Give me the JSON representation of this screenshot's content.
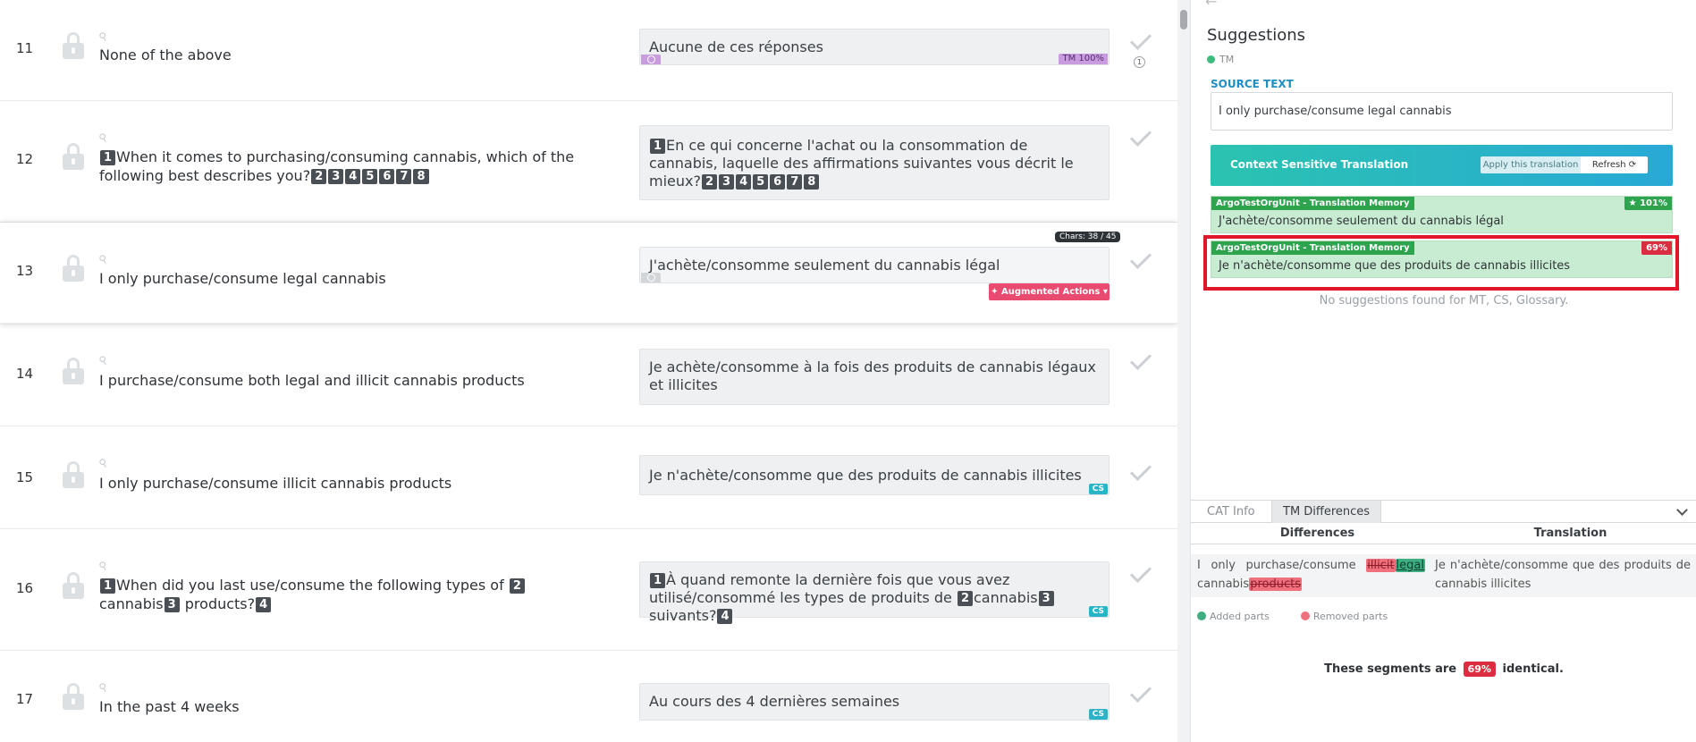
{
  "segments": [
    {
      "num": "11",
      "source": "None of the above",
      "target": "Aucune de ces réponses",
      "badge": "TM 100%"
    },
    {
      "num": "12",
      "source_a": "When it comes to purchasing/consuming cannabis, which of the following best describes you?",
      "tags_src": [
        "1",
        "2",
        "3",
        "4",
        "5",
        "6",
        "7",
        "8"
      ],
      "target_a": "En ce qui concerne l'achat ou la consommation de cannabis, laquelle des affirmations suivantes vous décrit le mieux?"
    },
    {
      "num": "13",
      "source": "I only purchase/consume legal cannabis",
      "target": "J'achète/consomme seulement du cannabis légal",
      "chars": "Chars: 38 / 45",
      "augmented": "Augmented Actions"
    },
    {
      "num": "14",
      "source": "I purchase/consume both legal and illicit cannabis products",
      "target": "Je achète/consomme à la fois des produits de cannabis légaux et illicites"
    },
    {
      "num": "15",
      "source": "I only purchase/consume illicit cannabis products",
      "target": "Je n'achète/consomme que des produits de cannabis illicites",
      "badge": "CS"
    },
    {
      "num": "16",
      "source_a": "When did you last use/consume the following types of",
      "source_b": "cannabis",
      "source_c": "products?",
      "target_a": "À quand remonte la dernière fois que vous avez utilisé/consommé les types de produits de",
      "target_b": "cannabis",
      "target_c": "suivants?",
      "badge": "CS"
    },
    {
      "num": "17",
      "source": "In the past 4 weeks",
      "target": "Au cours des 4 dernières semaines",
      "badge": "CS"
    }
  ],
  "panel": {
    "title": "Suggestions",
    "tm_legend": "TM",
    "source_label": "SOURCE TEXT",
    "source_text": "I only purchase/consume legal cannabis",
    "cst_label": "Context Sensitive Translation",
    "apply_label": "Apply this translation",
    "refresh_label": "Refresh",
    "tm1": {
      "org": "ArgoTestOrgUnit - Translation Memory",
      "pct": "101%",
      "text": "J'achète/consomme seulement du cannabis légal"
    },
    "tm2": {
      "org": "ArgoTestOrgUnit - Translation Memory",
      "pct": "69%",
      "text": "Je n'achète/consomme que des produits de cannabis illicites"
    },
    "no_suggestions": "No suggestions found for MT, CS, Glossary.",
    "tab_cat": "CAT Info",
    "tab_tmdiff": "TM Differences",
    "diff_head": "Differences",
    "trans_head": "Translation",
    "diff_pre": "I only purchase/consume",
    "diff_removed1": "illicit",
    "diff_added": "legal",
    "diff_mid": "cannabis",
    "diff_removed2": "products",
    "diff_translation": "Je n'achète/consomme que des produits de cannabis illicites",
    "legend_added": "Added parts",
    "legend_removed": "Removed parts",
    "identical_pre": "These segments are",
    "identical_pct": "69%",
    "identical_post": "identical."
  },
  "colors": {
    "accent": "#1f8fc2",
    "added": "#3fae83",
    "removed": "#f1707d",
    "highlight": "#e0162b",
    "tm_green": "#2ea44f"
  }
}
